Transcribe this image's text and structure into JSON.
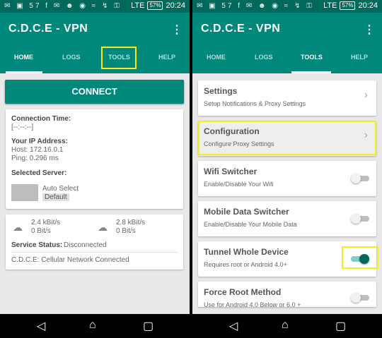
{
  "left": {
    "status": {
      "icons": "✉ ▣ 57 f ✉ ☻ ◉ ≈ ↯ ⚿",
      "network": "LTE",
      "battery": "57%",
      "time": "20:24"
    },
    "app_title": "C.D.C.E - VPN",
    "tabs": [
      "HOME",
      "LOGS",
      "TOOLS",
      "HELP"
    ],
    "connect_label": "CONNECT",
    "connection_time_label": "Connection Time:",
    "connection_time_value": "[--:--:--]",
    "ip_label": "Your IP Address:",
    "host": "Host: 172.16.0.1",
    "ping": "Ping: 0.296 ms",
    "server_label": "Selected Server:",
    "server_name": "Auto Select",
    "server_badge": "Default",
    "down_speed": "2.4 kBit/s",
    "down_total": "0 Bit/s",
    "up_speed": "2.8 kBit/s",
    "up_total": "0 Bit/s",
    "service_status_label": "Service Status:",
    "service_status_value": "Disconnected",
    "network_status": "C.D.C.E:  Cellular Network Connected"
  },
  "right": {
    "status": {
      "icons": "✉ ▣ 57 f ✉ ☻ ◉ ≈ ↯ ⚿",
      "network": "LTE",
      "battery": "57%",
      "time": "20:24"
    },
    "app_title": "C.D.C.E - VPN",
    "tabs": [
      "HOME",
      "LOGS",
      "TOOLS",
      "HELP"
    ],
    "items": [
      {
        "title": "Settings",
        "subtitle": "Setup Notifications & Proxy Settings"
      },
      {
        "title": "Configuration",
        "subtitle": "Configure Proxy Settings"
      },
      {
        "title": "Wifi Switcher",
        "subtitle": "Enable/Disable Your Wifi",
        "on": false
      },
      {
        "title": "Mobile Data Switcher",
        "subtitle": "Enable/Disable Your Mobile Data",
        "on": false
      },
      {
        "title": "Tunnel Whole Device",
        "subtitle": "Requires root or Android 4.0+",
        "on": true
      },
      {
        "title": "Force Root Method",
        "subtitle": "Use for Android 4.0 Below or 6.0 +",
        "on": false
      }
    ]
  },
  "colors": {
    "primary": "#00897b",
    "status_bar": "#00695c",
    "highlight": "#f4ef19"
  },
  "icons": {
    "menu": "overflow-menu-icon",
    "chevron": "chevron-right-icon",
    "cloud_down": "cloud-download-icon",
    "cloud_up": "cloud-upload-icon",
    "back": "back-icon",
    "home": "home-icon",
    "recents": "recents-icon"
  }
}
